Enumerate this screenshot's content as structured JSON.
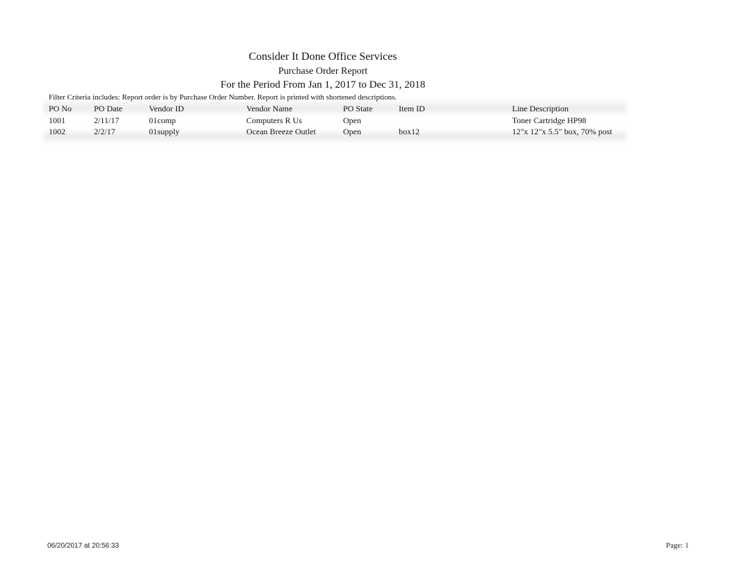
{
  "report": {
    "company": "Consider It Done Office Services",
    "name": "Purchase Order Report",
    "period": "For the Period From Jan 1, 2017 to Dec 31, 2018",
    "filter_criteria": "Filter Criteria includes: Report order is by Purchase Order Number. Report is printed with shortened descriptions."
  },
  "table": {
    "columns": [
      "PO No",
      "PO Date",
      "Vendor ID",
      "Vendor Name",
      "PO State",
      "Item ID",
      "Line Description"
    ],
    "rows": [
      [
        "1001",
        "2/11/17",
        "01comp",
        "Computers R Us",
        "Open",
        "",
        "Toner Cartridge HP98"
      ],
      [
        "1002",
        "2/2/17",
        "01supply",
        "Ocean Breeze Outlet",
        "Open",
        "box12",
        "12\"x 12\"x 5.5\" box, 70% post"
      ]
    ]
  },
  "footer": {
    "printed_at": "06/20/2017 at 20:56:33",
    "page": "Page: 1"
  }
}
